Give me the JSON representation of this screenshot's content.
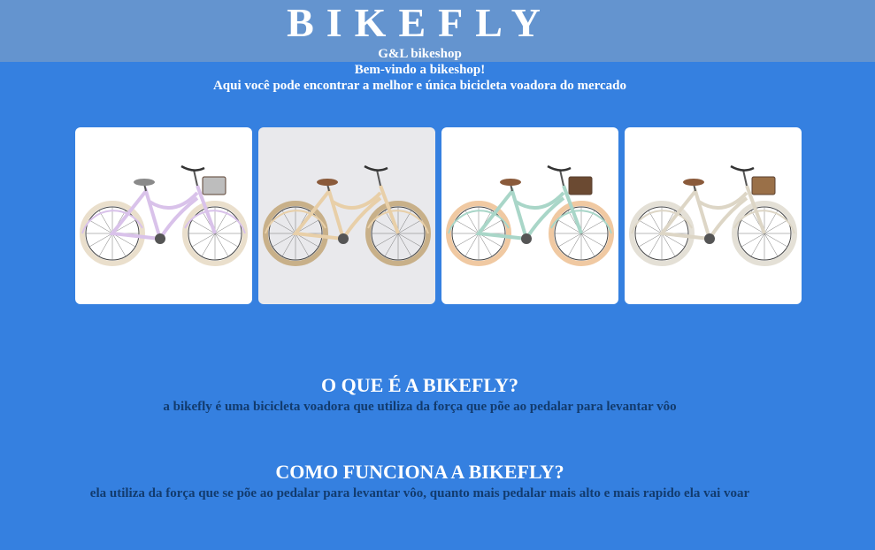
{
  "header": {
    "brand": "BIKEFLY",
    "shop_name": "G&L bikeshop",
    "welcome": "Bem-vindo a bikeshop!",
    "tagline": "Aqui você pode encontrar a melhor e única bicicleta voadora do mercado"
  },
  "gallery": {
    "items": [
      {
        "icon": "bicycle-lavender-image",
        "frame": "#d9c2ea",
        "tire": "#eadfcc",
        "basket": "#bdbdbd"
      },
      {
        "icon": "bicycle-cream-image",
        "frame": "#e8cfa8",
        "tire": "#c8b089",
        "basket": "none"
      },
      {
        "icon": "bicycle-mint-image",
        "frame": "#a9d6c8",
        "tire": "#f0c9a2",
        "basket": "#6b4a32"
      },
      {
        "icon": "bicycle-beige-image",
        "frame": "#ddd6c6",
        "tire": "#e4e0d6",
        "basket": "#9a7048"
      }
    ]
  },
  "sections": [
    {
      "title": "O QUE É A BIKEFLY?",
      "text": "a bikefly é uma bicicleta voadora que utiliza da força que põe ao pedalar para levantar vôo"
    },
    {
      "title": "COMO FUNCIONA A BIKEFLY?",
      "text": "ela utiliza da força que se põe ao pedalar para levantar vôo, quanto mais pedalar mais alto e mais rapido ela vai voar"
    }
  ],
  "colors": {
    "background": "#3580e0",
    "header_band": "#6494cf",
    "body_text": "#123b6e"
  }
}
